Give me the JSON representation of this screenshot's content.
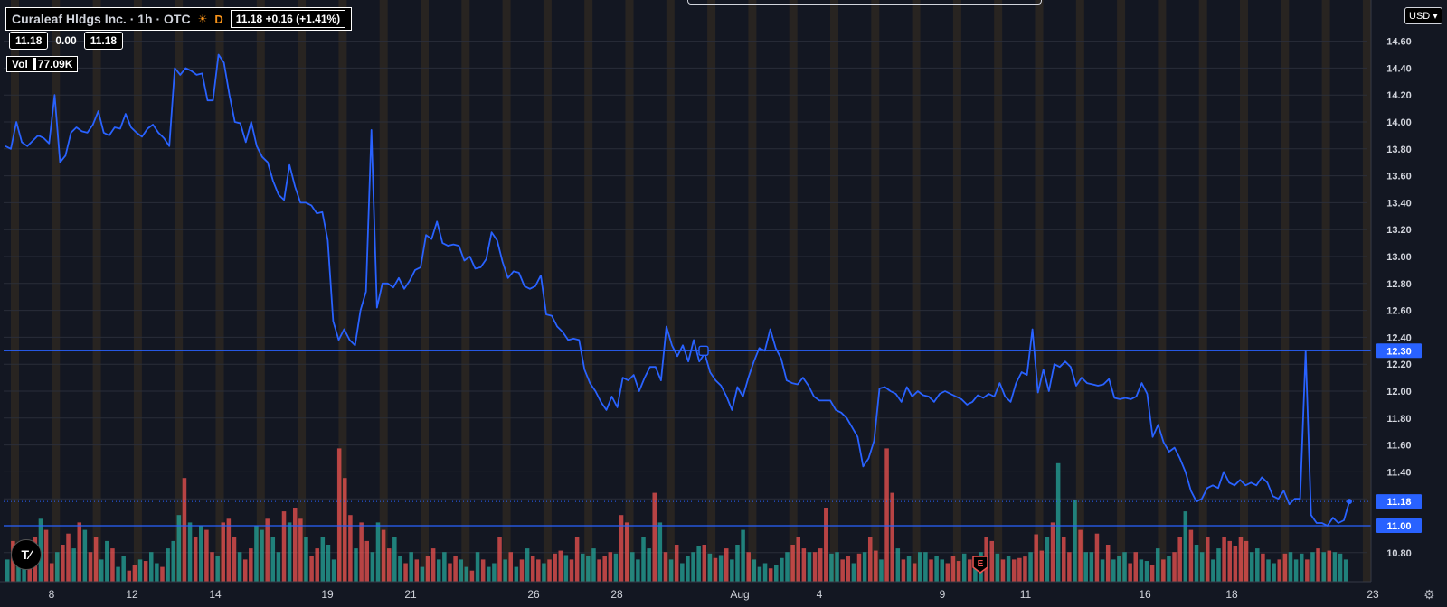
{
  "legend": {
    "symbol": "Curaleaf Hldgs Inc. · 1h · OTC",
    "session": "D",
    "change": "11.18 +0.16 (+1.41%)",
    "open": "11.18",
    "mid": "0.00",
    "close": "11.18",
    "volume_label": "Vol",
    "volume": "77.09K"
  },
  "currency": "USD",
  "logo_text": "T⁄",
  "chart_data": {
    "type": "line",
    "x_tick_labels": [
      "8",
      "12",
      "14",
      "19",
      "21",
      "26",
      "28",
      "Aug",
      "4",
      "9",
      "11",
      "16",
      "18",
      "23"
    ],
    "y_tick_labels": [
      "10.80",
      "11.00",
      "11.20",
      "11.40",
      "11.60",
      "11.80",
      "12.00",
      "12.20",
      "12.40",
      "12.60",
      "12.80",
      "13.00",
      "13.20",
      "13.40",
      "13.60",
      "13.80",
      "14.00",
      "14.20",
      "14.40",
      "14.60"
    ],
    "ylim": [
      10.7,
      14.72
    ],
    "price_series": [
      13.82,
      13.8,
      14.0,
      13.85,
      13.82,
      13.86,
      13.9,
      13.88,
      13.84,
      14.2,
      13.7,
      13.75,
      13.92,
      13.96,
      13.93,
      13.92,
      13.98,
      14.08,
      13.92,
      13.9,
      13.96,
      13.95,
      14.06,
      13.96,
      13.92,
      13.89,
      13.95,
      13.98,
      13.92,
      13.88,
      13.82,
      14.4,
      14.35,
      14.4,
      14.38,
      14.35,
      14.36,
      14.16,
      14.16,
      14.5,
      14.44,
      14.2,
      14.0,
      13.99,
      13.85,
      14.0,
      13.82,
      13.74,
      13.7,
      13.56,
      13.46,
      13.42,
      13.68,
      13.52,
      13.4,
      13.4,
      13.38,
      13.32,
      13.33,
      13.12,
      12.52,
      12.38,
      12.46,
      12.38,
      12.34,
      12.6,
      12.74,
      13.94,
      12.62,
      12.8,
      12.8,
      12.77,
      12.84,
      12.76,
      12.82,
      12.9,
      12.92,
      13.16,
      13.13,
      13.26,
      13.1,
      13.08,
      13.09,
      13.08,
      12.97,
      13.0,
      12.91,
      12.92,
      12.98,
      13.18,
      13.12,
      12.96,
      12.84,
      12.89,
      12.88,
      12.78,
      12.76,
      12.78,
      12.86,
      12.57,
      12.56,
      12.48,
      12.44,
      12.38,
      12.39,
      12.38,
      12.16,
      12.06,
      12.0,
      11.92,
      11.86,
      11.96,
      11.88,
      12.1,
      12.08,
      12.12,
      12.0,
      12.1,
      12.18,
      12.18,
      12.08,
      12.48,
      12.34,
      12.26,
      12.34,
      12.22,
      12.38,
      12.22,
      12.28,
      12.14,
      12.08,
      12.04,
      11.96,
      11.86,
      12.03,
      11.96,
      12.1,
      12.22,
      12.32,
      12.3,
      12.46,
      12.32,
      12.24,
      12.08,
      12.06,
      12.05,
      12.1,
      12.04,
      11.96,
      11.93,
      11.93,
      11.93,
      11.86,
      11.84,
      11.8,
      11.73,
      11.66,
      11.44,
      11.5,
      11.63,
      12.02,
      12.03,
      12.0,
      11.98,
      11.92,
      12.03,
      11.96,
      12.0,
      11.97,
      11.96,
      11.92,
      11.98,
      12.0,
      11.98,
      11.96,
      11.94,
      11.9,
      11.92,
      11.97,
      11.95,
      11.98,
      11.96,
      12.06,
      11.96,
      11.92,
      12.06,
      12.14,
      12.12,
      12.46,
      11.99,
      12.16,
      12.0,
      12.2,
      12.18,
      12.22,
      12.18,
      12.04,
      12.1,
      12.06,
      12.05,
      12.04,
      12.05,
      12.09,
      11.95,
      11.94,
      11.95,
      11.94,
      11.96,
      12.06,
      11.98,
      11.66,
      11.75,
      11.62,
      11.55,
      11.58,
      11.5,
      11.4,
      11.26,
      11.18,
      11.2,
      11.28,
      11.3,
      11.28,
      11.4,
      11.32,
      11.3,
      11.34,
      11.3,
      11.32,
      11.3,
      11.36,
      11.32,
      11.22,
      11.2,
      11.26,
      11.16,
      11.2,
      11.2,
      12.3,
      11.08,
      11.02,
      11.02,
      11.0,
      11.06,
      11.02,
      11.04,
      11.18
    ],
    "volume_series": [
      [
        30,
        1
      ],
      [
        55,
        0
      ],
      [
        40,
        1
      ],
      [
        20,
        1
      ],
      [
        35,
        0
      ],
      [
        60,
        0
      ],
      [
        85,
        1
      ],
      [
        70,
        0
      ],
      [
        25,
        0
      ],
      [
        40,
        1
      ],
      [
        50,
        0
      ],
      [
        65,
        0
      ],
      [
        45,
        1
      ],
      [
        80,
        0
      ],
      [
        70,
        1
      ],
      [
        40,
        0
      ],
      [
        60,
        0
      ],
      [
        30,
        1
      ],
      [
        55,
        1
      ],
      [
        45,
        0
      ],
      [
        20,
        1
      ],
      [
        35,
        1
      ],
      [
        15,
        0
      ],
      [
        22,
        0
      ],
      [
        30,
        1
      ],
      [
        28,
        0
      ],
      [
        40,
        1
      ],
      [
        25,
        1
      ],
      [
        20,
        0
      ],
      [
        45,
        1
      ],
      [
        55,
        1
      ],
      [
        90,
        1
      ],
      [
        140,
        0
      ],
      [
        80,
        1
      ],
      [
        60,
        0
      ],
      [
        75,
        1
      ],
      [
        70,
        0
      ],
      [
        40,
        0
      ],
      [
        35,
        1
      ],
      [
        80,
        0
      ],
      [
        85,
        0
      ],
      [
        60,
        0
      ],
      [
        40,
        1
      ],
      [
        30,
        0
      ],
      [
        45,
        0
      ],
      [
        75,
        1
      ],
      [
        70,
        1
      ],
      [
        85,
        0
      ],
      [
        60,
        1
      ],
      [
        40,
        1
      ],
      [
        95,
        0
      ],
      [
        80,
        1
      ],
      [
        100,
        0
      ],
      [
        85,
        0
      ],
      [
        60,
        1
      ],
      [
        35,
        0
      ],
      [
        45,
        0
      ],
      [
        60,
        1
      ],
      [
        50,
        1
      ],
      [
        30,
        1
      ],
      [
        180,
        0
      ],
      [
        140,
        0
      ],
      [
        90,
        0
      ],
      [
        45,
        1
      ],
      [
        80,
        0
      ],
      [
        55,
        0
      ],
      [
        40,
        1
      ],
      [
        80,
        1
      ],
      [
        70,
        0
      ],
      [
        45,
        0
      ],
      [
        60,
        1
      ],
      [
        35,
        1
      ],
      [
        25,
        0
      ],
      [
        40,
        1
      ],
      [
        30,
        0
      ],
      [
        20,
        1
      ],
      [
        35,
        0
      ],
      [
        45,
        0
      ],
      [
        30,
        1
      ],
      [
        40,
        1
      ],
      [
        25,
        0
      ],
      [
        35,
        0
      ],
      [
        30,
        1
      ],
      [
        20,
        1
      ],
      [
        15,
        0
      ],
      [
        40,
        1
      ],
      [
        30,
        0
      ],
      [
        20,
        1
      ],
      [
        25,
        1
      ],
      [
        60,
        0
      ],
      [
        30,
        1
      ],
      [
        40,
        0
      ],
      [
        20,
        1
      ],
      [
        30,
        0
      ],
      [
        45,
        1
      ],
      [
        35,
        0
      ],
      [
        30,
        0
      ],
      [
        25,
        1
      ],
      [
        30,
        0
      ],
      [
        38,
        0
      ],
      [
        42,
        0
      ],
      [
        36,
        1
      ],
      [
        30,
        0
      ],
      [
        60,
        0
      ],
      [
        38,
        1
      ],
      [
        35,
        1
      ],
      [
        45,
        1
      ],
      [
        30,
        0
      ],
      [
        35,
        0
      ],
      [
        40,
        0
      ],
      [
        38,
        1
      ],
      [
        90,
        0
      ],
      [
        80,
        0
      ],
      [
        40,
        1
      ],
      [
        30,
        1
      ],
      [
        60,
        1
      ],
      [
        45,
        1
      ],
      [
        120,
        0
      ],
      [
        80,
        1
      ],
      [
        40,
        0
      ],
      [
        30,
        1
      ],
      [
        50,
        0
      ],
      [
        25,
        1
      ],
      [
        35,
        1
      ],
      [
        40,
        1
      ],
      [
        48,
        1
      ],
      [
        50,
        0
      ],
      [
        38,
        1
      ],
      [
        32,
        0
      ],
      [
        36,
        1
      ],
      [
        45,
        0
      ],
      [
        30,
        1
      ],
      [
        50,
        1
      ],
      [
        70,
        1
      ],
      [
        40,
        0
      ],
      [
        30,
        1
      ],
      [
        20,
        1
      ],
      [
        25,
        1
      ],
      [
        18,
        0
      ],
      [
        22,
        1
      ],
      [
        32,
        1
      ],
      [
        40,
        1
      ],
      [
        50,
        0
      ],
      [
        60,
        0
      ],
      [
        45,
        0
      ],
      [
        40,
        1
      ],
      [
        40,
        0
      ],
      [
        45,
        0
      ],
      [
        100,
        0
      ],
      [
        38,
        1
      ],
      [
        40,
        1
      ],
      [
        30,
        0
      ],
      [
        35,
        0
      ],
      [
        25,
        1
      ],
      [
        38,
        0
      ],
      [
        40,
        1
      ],
      [
        60,
        0
      ],
      [
        42,
        0
      ],
      [
        30,
        1
      ],
      [
        180,
        0
      ],
      [
        120,
        0
      ],
      [
        45,
        1
      ],
      [
        30,
        0
      ],
      [
        35,
        1
      ],
      [
        25,
        0
      ],
      [
        40,
        1
      ],
      [
        40,
        1
      ],
      [
        30,
        0
      ],
      [
        35,
        1
      ],
      [
        30,
        1
      ],
      [
        25,
        0
      ],
      [
        35,
        0
      ],
      [
        28,
        0
      ],
      [
        38,
        1
      ],
      [
        30,
        0
      ],
      [
        34,
        1
      ],
      [
        40,
        1
      ],
      [
        60,
        0
      ],
      [
        55,
        0
      ],
      [
        38,
        1
      ],
      [
        30,
        0
      ],
      [
        35,
        1
      ],
      [
        30,
        0
      ],
      [
        32,
        0
      ],
      [
        34,
        0
      ],
      [
        40,
        1
      ],
      [
        64,
        0
      ],
      [
        42,
        0
      ],
      [
        60,
        1
      ],
      [
        80,
        0
      ],
      [
        160,
        1
      ],
      [
        60,
        0
      ],
      [
        40,
        0
      ],
      [
        110,
        1
      ],
      [
        70,
        0
      ],
      [
        40,
        1
      ],
      [
        40,
        1
      ],
      [
        65,
        0
      ],
      [
        30,
        1
      ],
      [
        50,
        0
      ],
      [
        30,
        1
      ],
      [
        35,
        1
      ],
      [
        40,
        1
      ],
      [
        25,
        0
      ],
      [
        40,
        0
      ],
      [
        30,
        1
      ],
      [
        28,
        1
      ],
      [
        22,
        0
      ],
      [
        45,
        1
      ],
      [
        30,
        0
      ],
      [
        35,
        1
      ],
      [
        40,
        0
      ],
      [
        60,
        0
      ],
      [
        95,
        1
      ],
      [
        70,
        0
      ],
      [
        50,
        1
      ],
      [
        40,
        1
      ],
      [
        60,
        0
      ],
      [
        30,
        1
      ],
      [
        45,
        1
      ],
      [
        60,
        0
      ],
      [
        55,
        0
      ],
      [
        48,
        0
      ],
      [
        60,
        0
      ],
      [
        55,
        0
      ],
      [
        40,
        1
      ],
      [
        45,
        1
      ],
      [
        38,
        0
      ],
      [
        30,
        1
      ],
      [
        25,
        1
      ],
      [
        30,
        0
      ],
      [
        38,
        0
      ],
      [
        40,
        1
      ],
      [
        30,
        1
      ],
      [
        38,
        1
      ],
      [
        30,
        0
      ],
      [
        40,
        1
      ],
      [
        45,
        0
      ],
      [
        40,
        1
      ],
      [
        42,
        0
      ],
      [
        40,
        1
      ],
      [
        38,
        1
      ],
      [
        30,
        1
      ]
    ],
    "horizontal_levels": [
      {
        "value": 12.3,
        "label": "12.30"
      },
      {
        "value": 11.0,
        "label": "11.00"
      }
    ],
    "last_price": {
      "value": 11.18,
      "label": "11.18"
    },
    "earnings_marker": "E",
    "grid": true,
    "colors": {
      "background": "#131722",
      "line": "#2962ff",
      "volume_up": "#26a69a",
      "volume_down": "#ef5350",
      "level": "#2962ff",
      "session_shade": "#3a2f20",
      "grid": "#2a2e39",
      "axis_text": "#d1d4dc"
    }
  }
}
